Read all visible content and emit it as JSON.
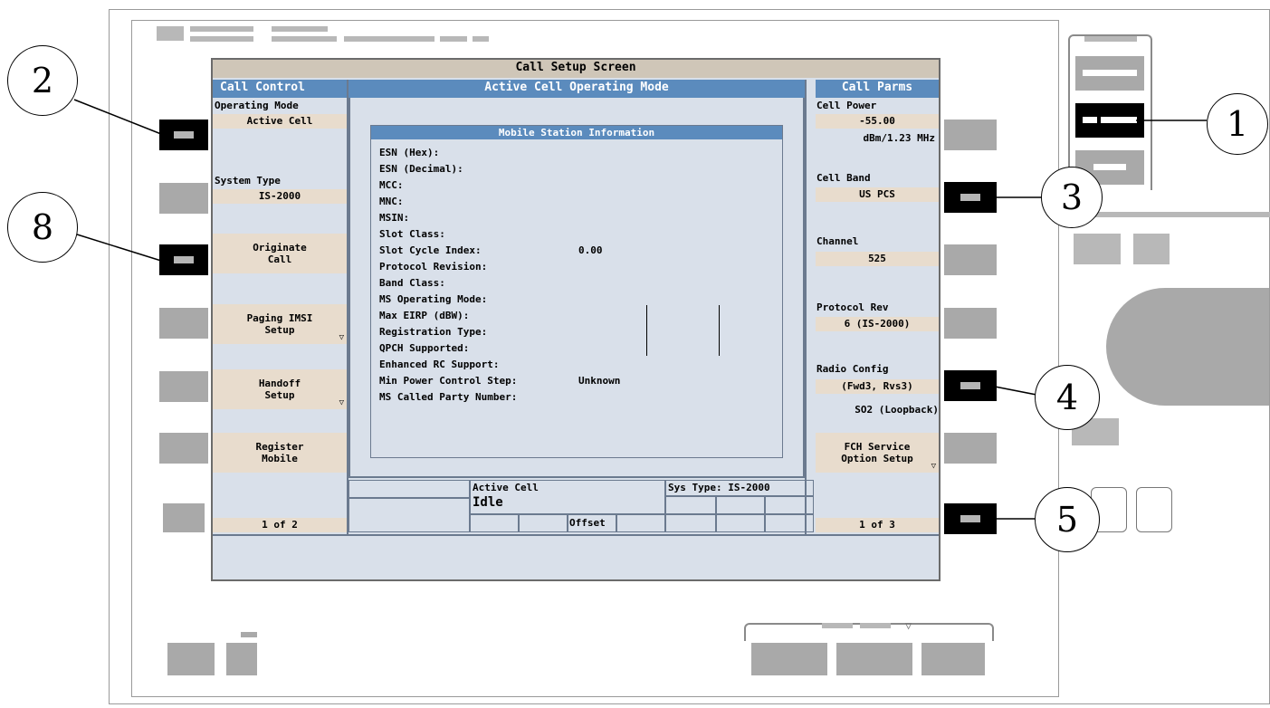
{
  "window": {
    "title": "Call Setup Screen"
  },
  "left_panel": {
    "header": "Call Control",
    "operating_mode_label": "Operating Mode",
    "operating_mode_value": "Active Cell",
    "system_type_label": "System Type",
    "system_type_value": "IS-2000",
    "originate_call": "Originate Call",
    "paging_imsi_setup": "Paging IMSI Setup",
    "handoff_setup": "Handoff Setup",
    "register_mobile": "Register Mobile",
    "page_indicator": "1 of 2"
  },
  "center": {
    "header": "Active Cell Operating Mode",
    "info_title": "Mobile Station Information",
    "rows": [
      {
        "label": "ESN (Hex):",
        "value": ""
      },
      {
        "label": "ESN (Decimal):",
        "value": ""
      },
      {
        "label": "MCC:",
        "value": ""
      },
      {
        "label": "MNC:",
        "value": ""
      },
      {
        "label": "MSIN:",
        "value": ""
      },
      {
        "label": "Slot Class:",
        "value": ""
      },
      {
        "label": "Slot Cycle Index:",
        "value": "0.00"
      },
      {
        "label": "Protocol Revision:",
        "value": ""
      },
      {
        "label": "Band Class:",
        "value": ""
      },
      {
        "label": "MS Operating Mode:",
        "value": ""
      },
      {
        "label": "Max EIRP (dBW):",
        "value": ""
      },
      {
        "label": "Registration Type:",
        "value": ""
      },
      {
        "label": "QPCH Supported:",
        "value": ""
      },
      {
        "label": "Enhanced RC Support:",
        "value": ""
      },
      {
        "label": "Min Power Control Step:",
        "value": "Unknown"
      },
      {
        "label": "MS Called Party Number:",
        "value": ""
      }
    ]
  },
  "status": {
    "cell_label": "Active Cell",
    "cell_state": "Idle",
    "sys_type": "Sys Type: IS-2000",
    "offset": "Offset"
  },
  "right_panel": {
    "header": "Call Parms",
    "cell_power_label": "Cell Power",
    "cell_power_value": "-55.00",
    "cell_power_unit": "dBm/1.23 MHz",
    "cell_band_label": "Cell Band",
    "cell_band_value": "US PCS",
    "channel_label": "Channel",
    "channel_value": "525",
    "protocol_rev_label": "Protocol Rev",
    "protocol_rev_value": "6 (IS-2000)",
    "radio_config_label": "Radio Config",
    "radio_config_value": "(Fwd3, Rvs3)",
    "service_option": "SO2 (Loopback)",
    "fch_service_option_setup": "FCH Service Option Setup",
    "page_indicator": "1 of 3"
  },
  "callouts": [
    "1",
    "2",
    "3",
    "4",
    "5",
    "8"
  ]
}
